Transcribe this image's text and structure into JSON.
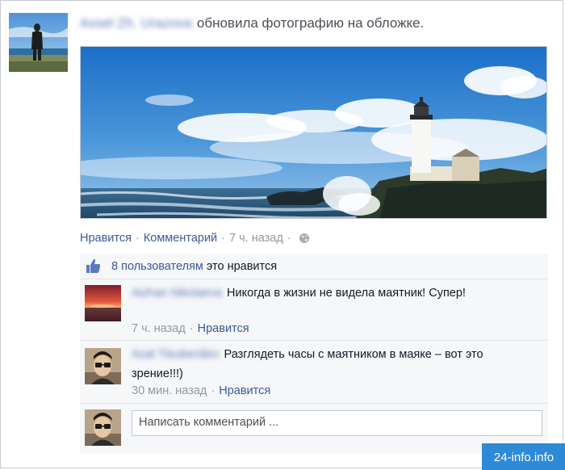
{
  "post": {
    "author_name": "Assel Zh. Urazova",
    "action_text": "обновила фотографию на обложке."
  },
  "actions": {
    "like": "Нравится",
    "comment": "Комментарий",
    "time": "7 ч. назад",
    "separator": "·"
  },
  "likes": {
    "count_text": "8 пользователям",
    "suffix": "это нравится"
  },
  "comments": [
    {
      "author": "Aizhan Nikolaeva",
      "text": "Никогда в жизни не видела маятник! Супер!",
      "time": "7 ч. назад",
      "like": "Нравится"
    },
    {
      "author": "Azat Tleuberdiev",
      "text": "Разглядеть часы с маятником в маяке – вот это зрение!!!)",
      "time": "30 мин. назад",
      "like": "Нравится"
    }
  ],
  "compose": {
    "placeholder": "Написать комментарий ..."
  },
  "watermark": "24-info.info",
  "colors": {
    "link": "#3b5998",
    "meta": "#9197a3",
    "panel_bg": "#f6f7f9",
    "watermark_bg": "#2d8ad6"
  }
}
